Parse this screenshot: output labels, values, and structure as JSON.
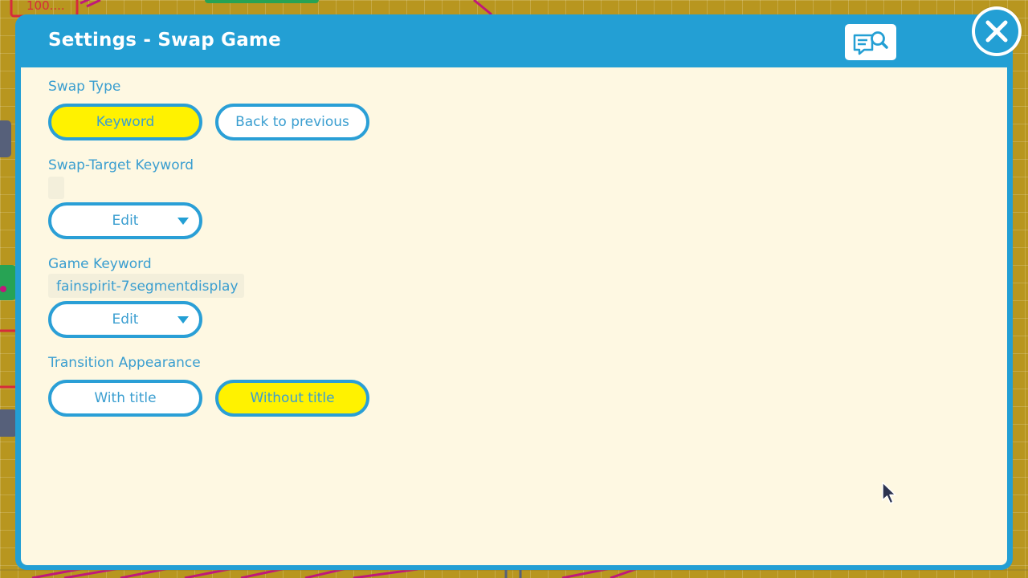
{
  "dialog": {
    "title": "Settings - Swap Game",
    "help_icon": "document-search-icon",
    "close_icon": "close-icon"
  },
  "swap_type": {
    "label": "Swap Type",
    "options": [
      "Keyword",
      "Back to previous"
    ],
    "selected": "Keyword"
  },
  "swap_target": {
    "label": "Swap-Target Keyword",
    "value": "",
    "edit_label": "Edit"
  },
  "game_keyword": {
    "label": "Game Keyword",
    "value": "fainspirit-7segmentdisplay",
    "edit_label": "Edit"
  },
  "transition": {
    "label": "Transition Appearance",
    "options": [
      "With title",
      "Without title"
    ],
    "selected": "Without title"
  },
  "background": {
    "node_text": "100...."
  },
  "colors": {
    "accent": "#239fd4",
    "panel": "#fef8e2",
    "selected": "#fff200",
    "text": "#3a9ed0"
  }
}
